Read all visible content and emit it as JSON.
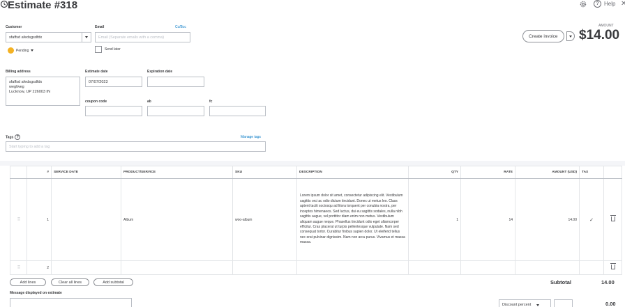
{
  "header": {
    "title": "Estimate #318",
    "help_label": "Help"
  },
  "customer": {
    "label": "Customer",
    "value": "sfaffsd afedsgsdfdx",
    "status": "Pending"
  },
  "email": {
    "label": "Email",
    "cc_bcc_link": "Cc/Bcc",
    "placeholder": "Email (Separate emails with a comma)",
    "send_later_label": "Send later"
  },
  "amount": {
    "label": "AMOUNT",
    "value": "$14.00",
    "create_invoice_label": "Create invoice"
  },
  "billing": {
    "label": "Billing address",
    "lines": [
      "sfaffsd afedsgsdfdx",
      "wegfweg",
      "Lucknow, UP  226003 IN"
    ]
  },
  "dates": {
    "estimate_date_label": "Estimate date",
    "estimate_date_value": "07/07/2023",
    "expiration_date_label": "Expiration date",
    "expiration_date_value": ""
  },
  "custom_fields": [
    {
      "label": "coupon code",
      "value": ""
    },
    {
      "label": "ab",
      "value": ""
    },
    {
      "label": "fc",
      "value": ""
    }
  ],
  "tags": {
    "label": "Tags",
    "manage_link": "Manage tags",
    "placeholder": "Start typing to add a tag"
  },
  "table": {
    "headers": [
      "",
      "#",
      "SERVICE DATE",
      "PRODUCT/SERVICE",
      "SKU",
      "DESCRIPTION",
      "QTY",
      "RATE",
      "AMOUNT (USD)",
      "TAX",
      ""
    ],
    "rows": [
      {
        "num": "1",
        "service_date": "",
        "product": "Album",
        "sku": "woo-album",
        "description": "Lorem ipsum dolor sit amet, consectetur adipiscing elit. Vestibulum sagittis orci ac odio dictum tincidunt. Donec ut metus leo. Class aptent taciti sociosqu ad litora torquent per conubia nostra, per inceptos himenaeos. Sed luctus, dui eu sagittis sodales, nulla nibh sagittis augue, vel porttitor diam enim non metus. Vestibulum aliquam augue neque. Phasellus tincidunt odio eget ullamcorper efficitur. Cras placerat ut turpis pellentesque vulputate. Nam sed consequat tortor. Curabitur finibus sapien dolor. Ut eleifend tellus nec erat pulvinar dignissim. Nam non arcu purus. Vivamus et massa massa.",
        "qty": "1",
        "rate": "14",
        "amount": "14.00",
        "tax": "✓"
      },
      {
        "num": "2",
        "service_date": "",
        "product": "",
        "sku": "",
        "description": "",
        "qty": "",
        "rate": "",
        "amount": "",
        "tax": ""
      }
    ]
  },
  "actions": {
    "add_lines": "Add lines",
    "clear_all_lines": "Clear all lines",
    "add_subtotal": "Add subtotal"
  },
  "totals": {
    "subtotal_label": "Subtotal",
    "subtotal_value": "14.00",
    "discount_type": "Discount percent",
    "discount_total": "0.00"
  },
  "message": {
    "label": "Message displayed on estimate"
  },
  "colors": {
    "link": "#0077c5",
    "pending": "#f4b223",
    "tax_check": "#2ca01c"
  }
}
